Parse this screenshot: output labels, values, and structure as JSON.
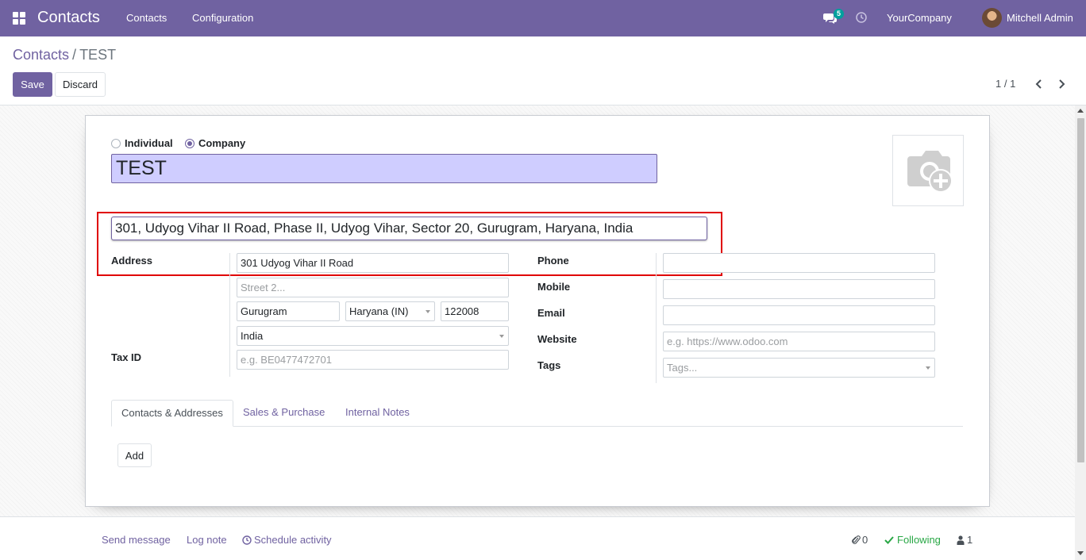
{
  "navbar": {
    "brand": "Contacts",
    "menu": [
      "Contacts",
      "Configuration"
    ],
    "messages_count": "5",
    "company": "YourCompany",
    "user": "Mitchell Admin"
  },
  "breadcrumb": {
    "parent": "Contacts",
    "separator": "/",
    "current": "TEST"
  },
  "actions": {
    "save": "Save",
    "discard": "Discard"
  },
  "pager": {
    "value": "1 / 1"
  },
  "form": {
    "type_options": [
      {
        "label": "Individual",
        "checked": false
      },
      {
        "label": "Company",
        "checked": true
      }
    ],
    "name": "TEST",
    "autocomplete": "301, Udyog Vihar II Road, Phase II, Udyog Vihar, Sector 20, Gurugram, Haryana, India",
    "labels": {
      "address": "Address",
      "tax_id": "Tax ID",
      "phone": "Phone",
      "mobile": "Mobile",
      "email": "Email",
      "website": "Website",
      "tags": "Tags"
    },
    "address": {
      "street": "301 Udyog Vihar II Road",
      "street2_placeholder": "Street 2...",
      "city": "Gurugram",
      "state": "Haryana (IN)",
      "zip": "122008",
      "country": "India"
    },
    "tax_id_placeholder": "e.g. BE0477472701",
    "phone": "",
    "mobile": "",
    "email": "",
    "website_placeholder": "e.g. https://www.odoo.com",
    "tags_placeholder": "Tags..."
  },
  "tabs": [
    {
      "label": "Contacts & Addresses",
      "active": true
    },
    {
      "label": "Sales & Purchase",
      "active": false
    },
    {
      "label": "Internal Notes",
      "active": false
    }
  ],
  "add_button": "Add",
  "chatter": {
    "send_message": "Send message",
    "log_note": "Log note",
    "schedule_activity": "Schedule activity",
    "attachments_count": "0",
    "following": "Following",
    "followers_count": "1"
  },
  "colors": {
    "primary": "#7062a1",
    "highlight_border": "#e00000",
    "name_field_bg": "#cfcdff",
    "following": "#28a745"
  }
}
